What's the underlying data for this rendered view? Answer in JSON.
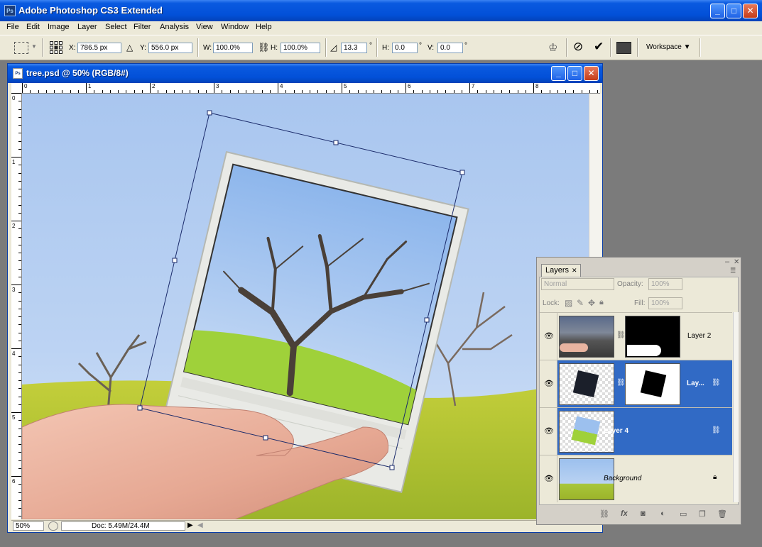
{
  "app": {
    "title": "Adobe Photoshop CS3 Extended",
    "icon_text": "Ps"
  },
  "window_controls": {
    "minimize": "_",
    "maximize": "□",
    "close": "✕"
  },
  "menu": [
    "File",
    "Edit",
    "Image",
    "Layer",
    "Select",
    "Filter",
    "Analysis",
    "View",
    "Window",
    "Help"
  ],
  "options": {
    "x_label": "X:",
    "x_value": "786.5 px",
    "y_label": "Y:",
    "y_value": "556.0 px",
    "w_label": "W:",
    "w_value": "100.0%",
    "h_label": "H:",
    "h_value": "100.0%",
    "angle_value": "13.3",
    "angle_unit": "°",
    "hskew_label": "H:",
    "hskew_value": "0.0",
    "hskew_unit": "°",
    "vskew_label": "V:",
    "vskew_value": "0.0",
    "vskew_unit": "°",
    "workspace_label": "Workspace ▼"
  },
  "document": {
    "title": "tree.psd @ 50% (RGB/8#)",
    "ruler_top": [
      "0",
      "1",
      "2",
      "3",
      "4",
      "5",
      "6",
      "7",
      "8"
    ],
    "ruler_left": [
      "0",
      "1",
      "2",
      "3",
      "4",
      "5",
      "6"
    ],
    "zoom": "50%",
    "doc_info": "Doc: 5.49M/24.4M"
  },
  "layers_panel": {
    "tab_label": "Layers",
    "tab_close": "✕",
    "blend_mode": "Normal",
    "opacity_label": "Opacity:",
    "opacity_value": "100%",
    "lock_label": "Lock:",
    "fill_label": "Fill:",
    "fill_value": "100%",
    "layers": [
      {
        "name": "Layer 2",
        "selected": false
      },
      {
        "name": "Lay...",
        "selected": true
      },
      {
        "name": "Layer 4",
        "selected": true
      },
      {
        "name": "Background",
        "selected": false
      }
    ]
  },
  "colors": {
    "xp_blue": "#0250d8",
    "selection": "#316ac5",
    "panel_bg": "#ece9d8"
  }
}
